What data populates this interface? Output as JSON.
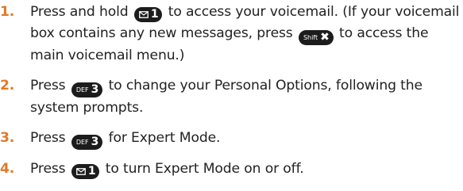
{
  "steps": [
    {
      "number": "1.",
      "text_a": "Press and hold",
      "key_a_main": "1",
      "key_a_icon": "envelope-icon",
      "text_b": "to access your voicemail. (If your voicemail box contains any new messages, press",
      "key_b_sub": "Shift",
      "key_b_main": "✖",
      "text_c": "to access the main voicemail menu.)"
    },
    {
      "number": "2.",
      "text_a": "Press",
      "key_a_sub": "DEF",
      "key_a_main": "3",
      "text_b": "to change your Personal Options, following the system prompts."
    },
    {
      "number": "3.",
      "text_a": "Press",
      "key_a_sub": "DEF",
      "key_a_main": "3",
      "text_b": "for Expert Mode."
    },
    {
      "number": "4.",
      "text_a": "Press",
      "key_a_main": "1",
      "key_a_icon": "envelope-icon",
      "text_b": "to turn Expert Mode on or off."
    }
  ],
  "colors": {
    "step_number": "#e07b25",
    "key_background": "#1c1c1c",
    "key_text": "#ffffff",
    "body_text": "#222222"
  }
}
